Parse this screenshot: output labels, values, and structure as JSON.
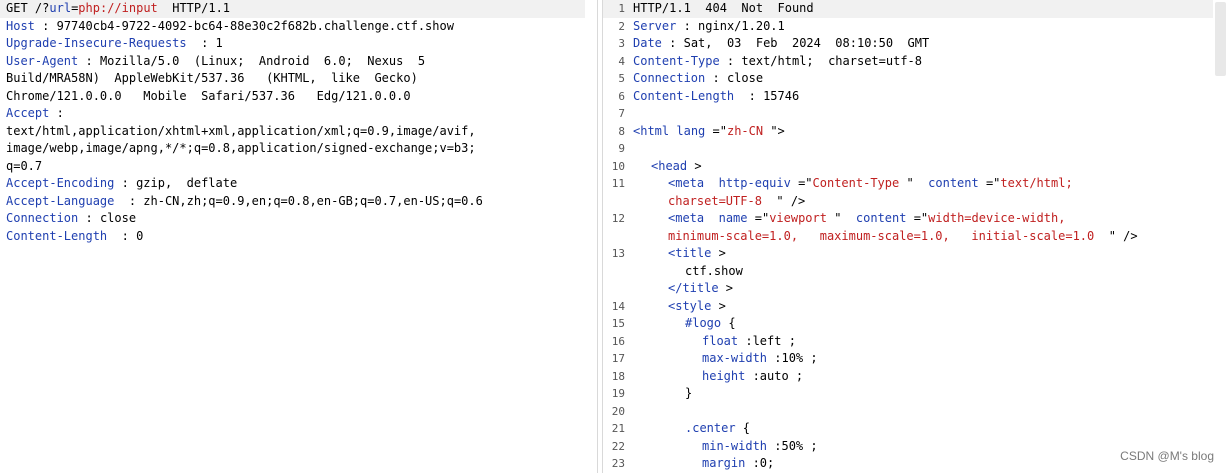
{
  "request": {
    "method_line": {
      "method": "GET",
      "sp1": " /?",
      "url_key": "url",
      "eq": "=",
      "url_val": "php://input",
      "rest": "  HTTP/1.1"
    },
    "lines": [
      {
        "name": "Host",
        "sep": " : ",
        "value": "97740cb4-9722-4092-bc64-88e30c2f682b.challenge.ctf.show"
      },
      {
        "name": "Upgrade-Insecure-Requests",
        "sep": "  : ",
        "value": "1"
      },
      {
        "name": "User-Agent",
        "sep": " : ",
        "value": "Mozilla/5.0  (Linux;  Android  6.0;  Nexus  5"
      },
      {
        "name": "",
        "sep": "",
        "value": "Build/MRA58N)  AppleWebKit/537.36   (KHTML,  like  Gecko)"
      },
      {
        "name": "",
        "sep": "",
        "value": "Chrome/121.0.0.0   Mobile  Safari/537.36   Edg/121.0.0.0"
      },
      {
        "name": "Accept",
        "sep": " :",
        "value": ""
      },
      {
        "name": "",
        "sep": "",
        "value": "text/html,application/xhtml+xml,application/xml;q=0.9,image/avif,"
      },
      {
        "name": "",
        "sep": "",
        "value": "image/webp,image/apng,*/*;q=0.8,application/signed-exchange;v=b3;"
      },
      {
        "name": "",
        "sep": "",
        "value": "q=0.7"
      },
      {
        "name": "Accept-Encoding",
        "sep": " : ",
        "value": "gzip,  deflate"
      },
      {
        "name": "Accept-Language",
        "sep": "  : ",
        "value": "zh-CN,zh;q=0.9,en;q=0.8,en-GB;q=0.7,en-US;q=0.6"
      },
      {
        "name": "Connection",
        "sep": " : ",
        "value": "close"
      },
      {
        "name": "Content-Length",
        "sep": "  : ",
        "value": "0"
      }
    ]
  },
  "response": {
    "line_numbers": [
      "1",
      "2",
      "3",
      "4",
      "5",
      "6",
      "7",
      "8",
      "9",
      "10",
      "11",
      "",
      "12",
      "",
      "13",
      "",
      "",
      "14",
      "15",
      "16",
      "17",
      "18",
      "19",
      "20",
      "21",
      "22",
      "23"
    ],
    "status_line": "HTTP/1.1  404  Not  Found",
    "headers": [
      {
        "name": "Server",
        "sep": " : ",
        "value": "nginx/1.20.1"
      },
      {
        "name": "Date",
        "sep": " : ",
        "value": "Sat,  03  Feb  2024  08:10:50  GMT"
      },
      {
        "name": "Content-Type",
        "sep": " : ",
        "value": "text/html;  charset=utf-8"
      },
      {
        "name": "Connection",
        "sep": " : ",
        "value": "close"
      },
      {
        "name": "Content-Length",
        "sep": "  : ",
        "value": "15746"
      }
    ],
    "body": {
      "html_open": "<",
      "html_tag": "html",
      "html_attr": "lang",
      "html_eq": " =\"",
      "html_val": "zh-CN",
      "html_close": " \">",
      "head_open": "<",
      "head_tag": "head",
      "head_close": " >",
      "meta1_a": "<",
      "meta1_tag": "meta",
      "meta1_attr1": "http-equiv",
      "meta1_eq1": " =\"",
      "meta1_val1": "Content-Type",
      "meta1_q1": " \" ",
      "meta1_attr2": "content",
      "meta1_eq2": " =\"",
      "meta1_val2": "text/html;",
      "meta1_cont_val": "charset=UTF-8",
      "meta1_cont_end": "  \" />",
      "meta2_a": "<",
      "meta2_tag": "meta",
      "meta2_attr1": "name",
      "meta2_eq1": " =\"",
      "meta2_val1": "viewport",
      "meta2_q1": " \" ",
      "meta2_attr2": "content",
      "meta2_eq2": " =\"",
      "meta2_val2": "width=device-width,",
      "meta2_cont_val": "minimum-scale=1.0,   maximum-scale=1.0,   initial-scale=1.0",
      "meta2_cont_end": "  \" />",
      "title_open": "<",
      "title_tag": "title",
      "title_close": " >",
      "title_text": "ctf.show",
      "title_end_open": "</",
      "title_end_tag": "title",
      "title_end_close": " >",
      "style_open": "<",
      "style_tag": "style",
      "style_close": " >",
      "css_logo_sel": "#logo",
      "css_logo_brace": " {",
      "css_float_prop": "float",
      "css_float_val": " :left ;",
      "css_maxw_prop": "max-width",
      "css_maxw_val": " :10% ;",
      "css_height_prop": "height",
      "css_height_val": " :auto ;",
      "css_close1": "}",
      "css_center_sel": ".center",
      "css_center_brace": " {",
      "css_minw_prop": "min-width",
      "css_minw_val": " :50% ;",
      "css_margin_prop": "margin",
      "css_margin_val": " :0;"
    }
  },
  "watermark": "CSDN @M's blog",
  "colors": {
    "header_name": "#1f3fb0",
    "value_red": "#c02020",
    "line_bg": "#f1f1f1"
  }
}
